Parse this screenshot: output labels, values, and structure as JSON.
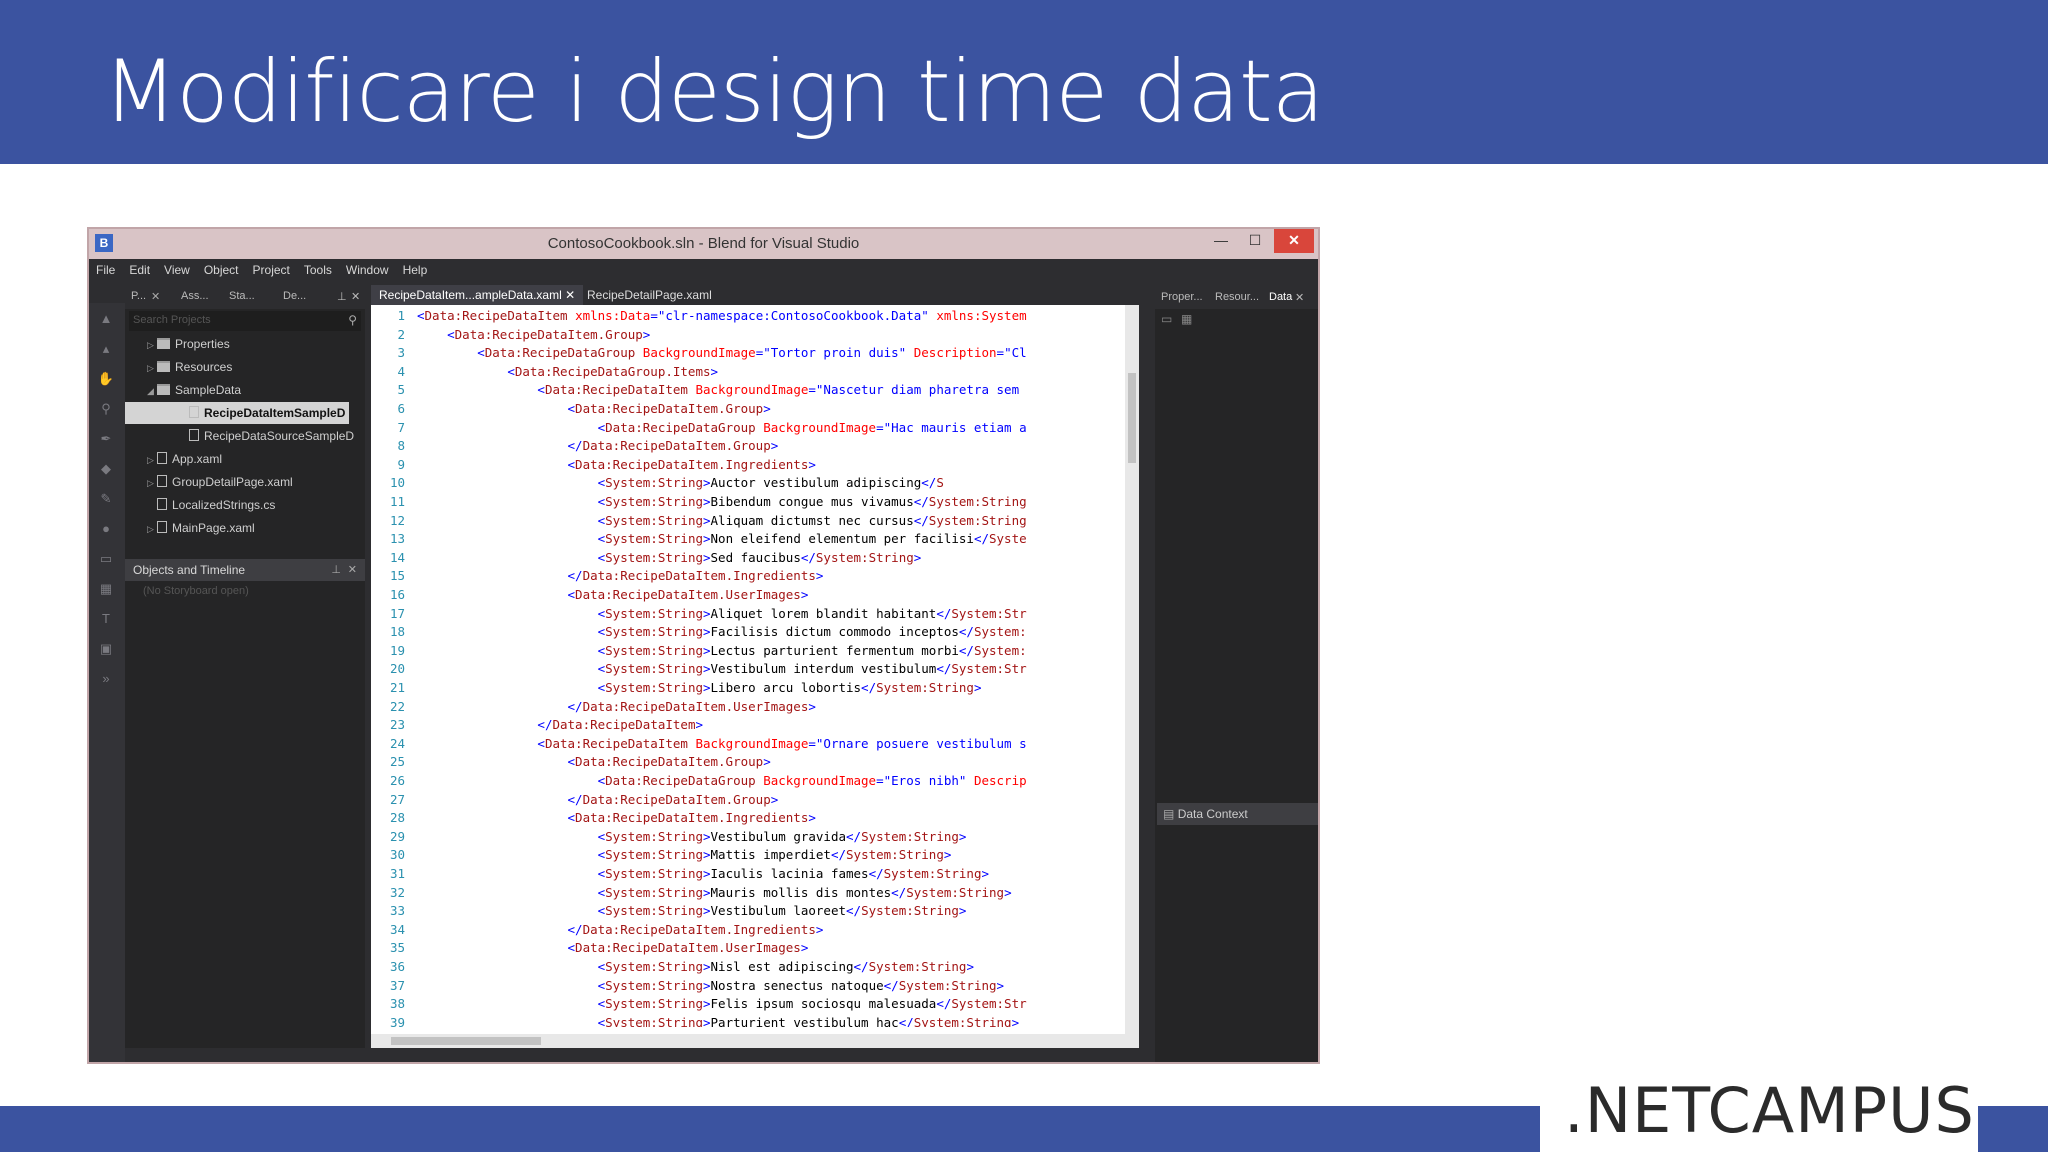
{
  "slide": {
    "title": "Modificare i design time data",
    "logo": ".NETCAMPUS"
  },
  "window": {
    "title": "ContosoCookbook.sln - Blend for Visual Studio",
    "app_icon": "B",
    "controls": {
      "minimize": "—",
      "maximize": "☐",
      "close": "✕"
    }
  },
  "menu": [
    "File",
    "Edit",
    "View",
    "Object",
    "Project",
    "Tools",
    "Window",
    "Help"
  ],
  "left_panel": {
    "tabs": [
      "P...",
      "Ass...",
      "Sta...",
      "De..."
    ],
    "search_placeholder": "Search Projects",
    "tree": [
      {
        "label": "Properties",
        "type": "folder"
      },
      {
        "label": "Resources",
        "type": "folder"
      },
      {
        "label": "SampleData",
        "type": "folder"
      },
      {
        "label": "RecipeDataItemSampleD",
        "type": "file"
      },
      {
        "label": "RecipeDataSourceSampleD",
        "type": "file"
      },
      {
        "label": "App.xaml",
        "type": "file"
      },
      {
        "label": "GroupDetailPage.xaml",
        "type": "file"
      },
      {
        "label": "LocalizedStrings.cs",
        "type": "file"
      },
      {
        "label": "MainPage.xaml",
        "type": "file"
      }
    ],
    "objects_header": "Objects and Timeline",
    "storyboard": "(No Storyboard open)"
  },
  "editor": {
    "tabs": [
      "RecipeDataItem...ampleData.xaml",
      "RecipeDetailPage.xaml"
    ],
    "lines": [
      "<Data:RecipeDataItem xmlns:Data=\"clr-namespace:ContosoCookbook.Data\" xmlns:System",
      "    <Data:RecipeDataItem.Group>",
      "        <Data:RecipeDataGroup BackgroundImage=\"Tortor proin duis\" Description=\"Cl",
      "            <Data:RecipeDataGroup.Items>",
      "                <Data:RecipeDataItem BackgroundImage=\"Nascetur diam pharetra sem",
      "                    <Data:RecipeDataItem.Group>",
      "                        <Data:RecipeDataGroup BackgroundImage=\"Hac mauris etiam a",
      "                    </Data:RecipeDataItem.Group>",
      "                    <Data:RecipeDataItem.Ingredients>",
      "                        <System:String>Auctor vestibulum adipiscing</S",
      "                        <System:String>Bibendum congue mus vivamus</System:String",
      "                        <System:String>Aliquam dictumst nec cursus</System:String",
      "                        <System:String>Non eleifend elementum per facilisi</Syste",
      "                        <System:String>Sed faucibus</System:String>",
      "                    </Data:RecipeDataItem.Ingredients>",
      "                    <Data:RecipeDataItem.UserImages>",
      "                        <System:String>Aliquet lorem blandit habitant</System:Str",
      "                        <System:String>Facilisis dictum commodo inceptos</System:",
      "                        <System:String>Lectus parturient fermentum morbi</System:",
      "                        <System:String>Vestibulum interdum vestibulum</System:Str",
      "                        <System:String>Libero arcu lobortis</System:String>",
      "                    </Data:RecipeDataItem.UserImages>",
      "                </Data:RecipeDataItem>",
      "                <Data:RecipeDataItem BackgroundImage=\"Ornare posuere vestibulum s",
      "                    <Data:RecipeDataItem.Group>",
      "                        <Data:RecipeDataGroup BackgroundImage=\"Eros nibh\" Descrip",
      "                    </Data:RecipeDataItem.Group>",
      "                    <Data:RecipeDataItem.Ingredients>",
      "                        <System:String>Vestibulum gravida</System:String>",
      "                        <System:String>Mattis imperdiet</System:String>",
      "                        <System:String>Iaculis lacinia fames</System:String>",
      "                        <System:String>Mauris mollis dis montes</System:String>",
      "                        <System:String>Vestibulum laoreet</System:String>",
      "                    </Data:RecipeDataItem.Ingredients>",
      "                    <Data:RecipeDataItem.UserImages>",
      "                        <System:String>Nisl est adipiscing</System:String>",
      "                        <System:String>Nostra senectus natoque</System:String>",
      "                        <System:String>Felis ipsum sociosqu malesuada</System:Str",
      "                        <System:String>Parturient vestibulum hac</System:String>"
    ]
  },
  "right_panel": {
    "tabs": [
      "Proper...",
      "Resour...",
      "Data"
    ],
    "data_context": "Data Context"
  },
  "colors": {
    "slide_band": "#3b53a0",
    "ide_background": "#2d2d30",
    "titlebar": "#d9c4c6",
    "close_button": "#d9463b"
  }
}
